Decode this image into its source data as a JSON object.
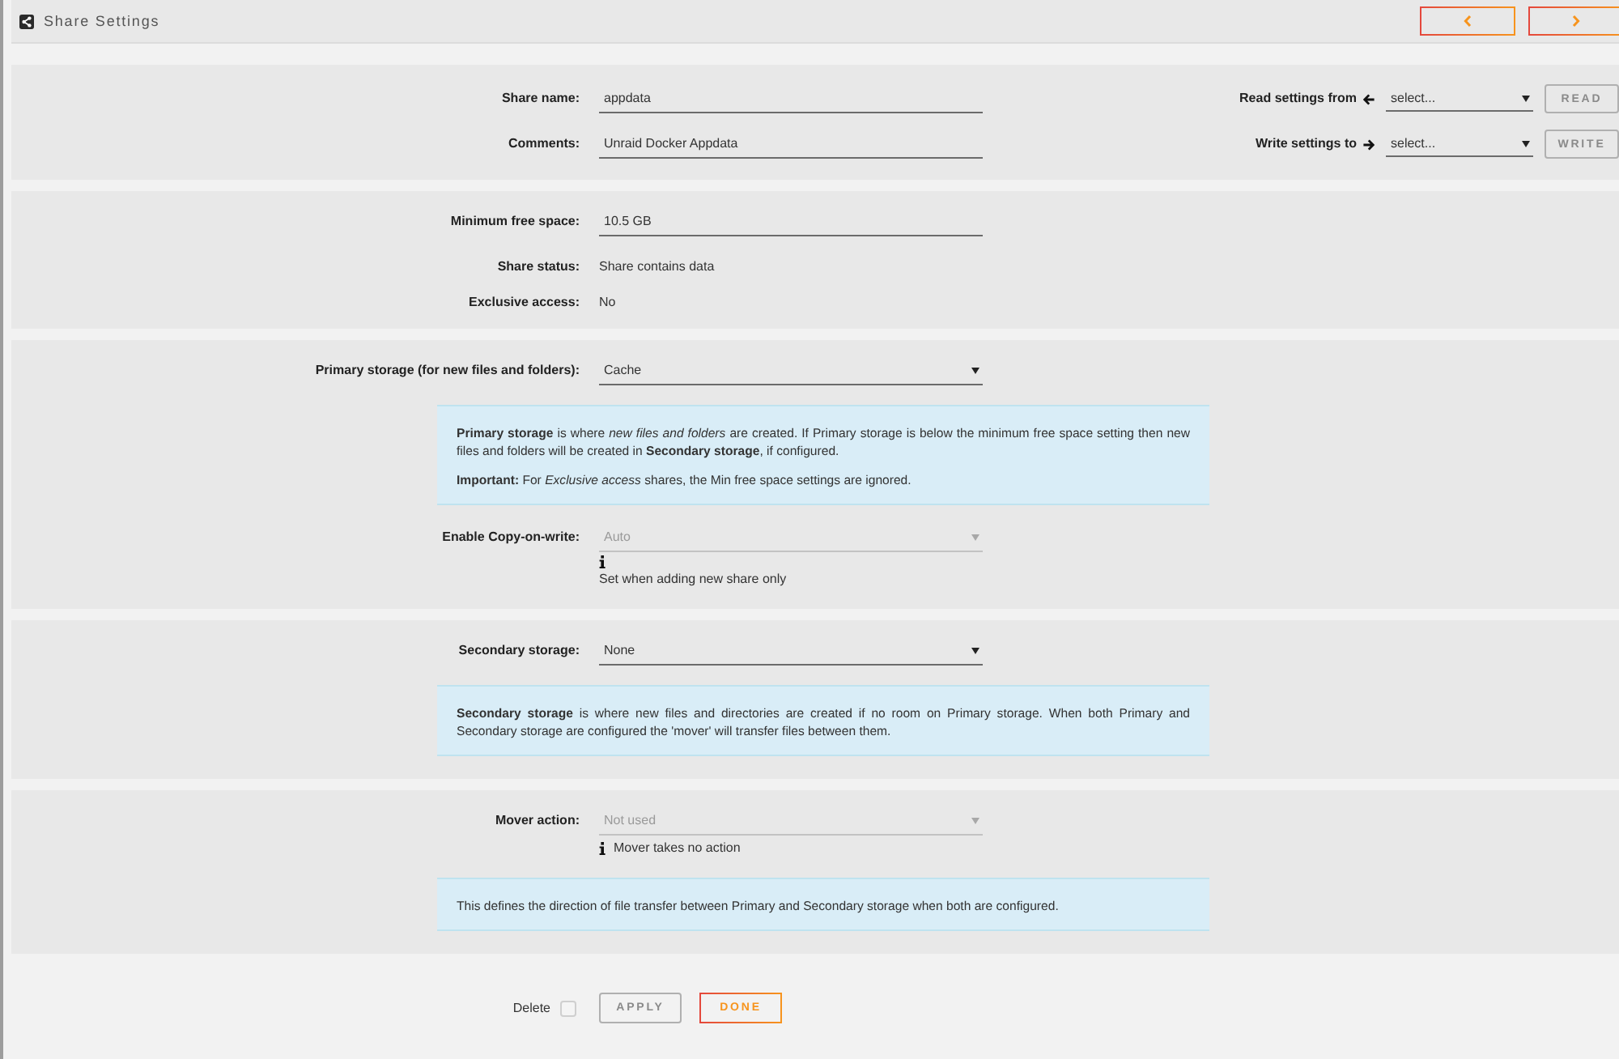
{
  "header": {
    "title": "Share Settings"
  },
  "sections": [
    {
      "rows": [
        {
          "kind": "input",
          "label": "Share name:",
          "value": "appdata"
        },
        {
          "kind": "input",
          "label": "Comments:",
          "value": "Unraid Docker Appdata"
        }
      ],
      "clone": [
        {
          "kind": "read",
          "label": "Read settings from",
          "value": "select...",
          "button": {
            "label": "READ",
            "disabled": true
          }
        },
        {
          "kind": "write",
          "label": "Write settings to",
          "value": "select...",
          "button": {
            "label": "WRITE",
            "disabled": true
          }
        }
      ]
    },
    {
      "rows": [
        {
          "kind": "input",
          "label": "Minimum free space:",
          "value": "10.5 GB"
        },
        {
          "kind": "text",
          "label": "Share status:",
          "value": "Share contains data"
        },
        {
          "kind": "text",
          "label": "Exclusive access:",
          "value": "No"
        }
      ]
    },
    {
      "rows": [
        {
          "kind": "select",
          "label": "Primary storage (for new files and folders):",
          "value": "Cache",
          "disabled": false
        },
        {
          "kind": "info",
          "paragraphs": [
            "**Primary storage** is where *new files and folders* are created. If Primary storage is below the minimum free space setting then new files and folders will be created in **Secondary storage**, if configured.",
            "**Important:** For *Exclusive access* shares, the Min free space settings are ignored."
          ]
        },
        {
          "kind": "select",
          "label": "Enable Copy-on-write:",
          "value": "Auto",
          "disabled": true,
          "note": {
            "kind": "stacked",
            "text": "Set when adding new share only"
          }
        }
      ]
    },
    {
      "rows": [
        {
          "kind": "select",
          "label": "Secondary storage:",
          "value": "None",
          "disabled": false
        },
        {
          "kind": "info",
          "paragraphs": [
            "**Secondary storage** is where new files and directories are created if no room on Primary storage. When both Primary and Secondary storage are configured the 'mover' will transfer files between them."
          ]
        }
      ]
    },
    {
      "rows": [
        {
          "kind": "select",
          "label": "Mover action:",
          "value": "Not used",
          "disabled": true,
          "note": {
            "kind": "inline",
            "text": "Mover takes no action"
          }
        },
        {
          "kind": "info",
          "paragraphs": [
            "This defines the direction of file transfer between Primary and Secondary storage when both are configured."
          ]
        }
      ]
    }
  ],
  "footer": {
    "delete": {
      "label": "Delete",
      "checked": false
    },
    "buttons": [
      {
        "label": "APPLY",
        "disabled": true
      },
      {
        "label": "DONE",
        "disabled": false
      }
    ]
  }
}
